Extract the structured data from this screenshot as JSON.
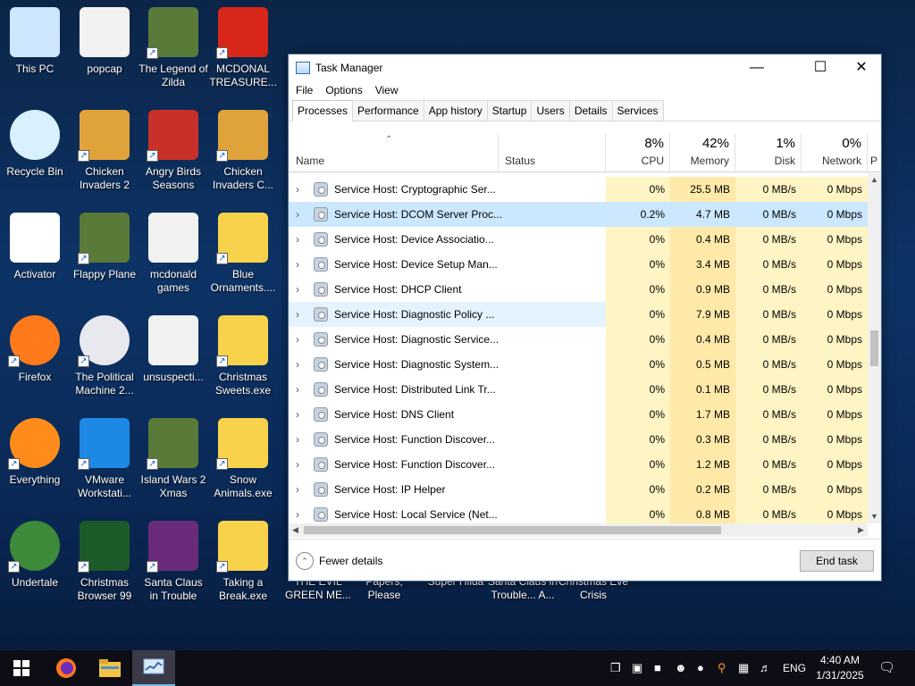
{
  "desktop": {
    "icons": [
      {
        "label": "This PC",
        "icon": "computer-icon"
      },
      {
        "label": "popcap",
        "icon": "folder-icon"
      },
      {
        "label": "The Legend of Zilda",
        "icon": "game-icon"
      },
      {
        "label": "MCDONAL TREASURE...",
        "icon": "mcdonalds-icon"
      },
      {
        "label": "Recycle Bin",
        "icon": "recycle-bin-icon"
      },
      {
        "label": "Chicken Invaders 2",
        "icon": "chicken-icon"
      },
      {
        "label": "Angry Birds Seasons",
        "icon": "angry-birds-icon"
      },
      {
        "label": "Chicken Invaders C...",
        "icon": "chicken-icon"
      },
      {
        "label": "Activator",
        "icon": "windows-file-icon"
      },
      {
        "label": "Flappy Plane",
        "icon": "game-icon"
      },
      {
        "label": "mcdonald games",
        "icon": "folder-icon"
      },
      {
        "label": "Blue Ornaments....",
        "icon": "setup-icon"
      },
      {
        "label": "Firefox",
        "icon": "firefox-icon"
      },
      {
        "label": "The Political Machine 2...",
        "icon": "political-machine-icon"
      },
      {
        "label": "unsuspecti...",
        "icon": "folder-icon"
      },
      {
        "label": "Christmas Sweets.exe",
        "icon": "setup-icon"
      },
      {
        "label": "Everything",
        "icon": "magnifier-icon"
      },
      {
        "label": "VMware Workstati...",
        "icon": "vmware-icon"
      },
      {
        "label": "Island Wars 2 Xmas",
        "icon": "game-icon"
      },
      {
        "label": "Snow Animals.exe",
        "icon": "setup-icon"
      },
      {
        "label": "Undertale",
        "icon": "undertale-icon"
      },
      {
        "label": "Christmas Browser 99",
        "icon": "christmas-tree-icon"
      },
      {
        "label": "Santa Claus in Trouble",
        "icon": "santa-icon"
      },
      {
        "label": "Taking a Break.exe",
        "icon": "setup-icon"
      }
    ],
    "hidden_labels": [
      "THE EVIL GREEN ME...",
      "Papers, Please",
      "Super Hilda",
      "Santa Claus in Trouble... A...",
      "Christmas Eve Crisis"
    ]
  },
  "taskmanager": {
    "title": "Task Manager",
    "menu": [
      "File",
      "Options",
      "View"
    ],
    "tabs": [
      "Processes",
      "Performance",
      "App history",
      "Startup",
      "Users",
      "Details",
      "Services"
    ],
    "active_tab": "Processes",
    "columns": {
      "name": "Name",
      "status": "Status",
      "cpu": {
        "pct": "8%",
        "label": "CPU"
      },
      "memory": {
        "pct": "42%",
        "label": "Memory"
      },
      "disk": {
        "pct": "1%",
        "label": "Disk"
      },
      "network": {
        "pct": "0%",
        "label": "Network"
      },
      "extra": "P"
    },
    "rows": [
      {
        "name": "Service Host: Cryptographic Ser...",
        "cpu": "0%",
        "memory": "25.5 MB",
        "disk": "0 MB/s",
        "network": "0 Mbps"
      },
      {
        "name": "Service Host: DCOM Server Proc...",
        "cpu": "0.2%",
        "memory": "4.7 MB",
        "disk": "0 MB/s",
        "network": "0 Mbps"
      },
      {
        "name": "Service Host: Device Associatio...",
        "cpu": "0%",
        "memory": "0.4 MB",
        "disk": "0 MB/s",
        "network": "0 Mbps"
      },
      {
        "name": "Service Host: Device Setup Man...",
        "cpu": "0%",
        "memory": "3.4 MB",
        "disk": "0 MB/s",
        "network": "0 Mbps"
      },
      {
        "name": "Service Host: DHCP Client",
        "cpu": "0%",
        "memory": "0.9 MB",
        "disk": "0 MB/s",
        "network": "0 Mbps"
      },
      {
        "name": "Service Host: Diagnostic Policy ...",
        "cpu": "0%",
        "memory": "7.9 MB",
        "disk": "0 MB/s",
        "network": "0 Mbps"
      },
      {
        "name": "Service Host: Diagnostic Service...",
        "cpu": "0%",
        "memory": "0.4 MB",
        "disk": "0 MB/s",
        "network": "0 Mbps"
      },
      {
        "name": "Service Host: Diagnostic System...",
        "cpu": "0%",
        "memory": "0.5 MB",
        "disk": "0 MB/s",
        "network": "0 Mbps"
      },
      {
        "name": "Service Host: Distributed Link Tr...",
        "cpu": "0%",
        "memory": "0.1 MB",
        "disk": "0 MB/s",
        "network": "0 Mbps"
      },
      {
        "name": "Service Host: DNS Client",
        "cpu": "0%",
        "memory": "1.7 MB",
        "disk": "0 MB/s",
        "network": "0 Mbps"
      },
      {
        "name": "Service Host: Function Discover...",
        "cpu": "0%",
        "memory": "0.3 MB",
        "disk": "0 MB/s",
        "network": "0 Mbps"
      },
      {
        "name": "Service Host: Function Discover...",
        "cpu": "0%",
        "memory": "1.2 MB",
        "disk": "0 MB/s",
        "network": "0 Mbps"
      },
      {
        "name": "Service Host: IP Helper",
        "cpu": "0%",
        "memory": "0.2 MB",
        "disk": "0 MB/s",
        "network": "0 Mbps"
      },
      {
        "name": "Service Host: Local Service (Net...",
        "cpu": "0%",
        "memory": "0.8 MB",
        "disk": "0 MB/s",
        "network": "0 Mbps"
      }
    ],
    "selected_row": 1,
    "hover_row": 5,
    "fewer_details": "Fewer details",
    "end_task": "End task"
  },
  "taskbar": {
    "pinned": [
      "windows-start-icon",
      "firefox-icon",
      "file-explorer-icon",
      "task-manager-icon"
    ],
    "language": "ENG",
    "time": "4:40 AM",
    "date": "1/31/2025"
  },
  "colors": {
    "accent": "#0078d7",
    "selection": "#cce8ff",
    "heat_light": "#fff4c4",
    "heat_mid": "#ffe9a8"
  }
}
